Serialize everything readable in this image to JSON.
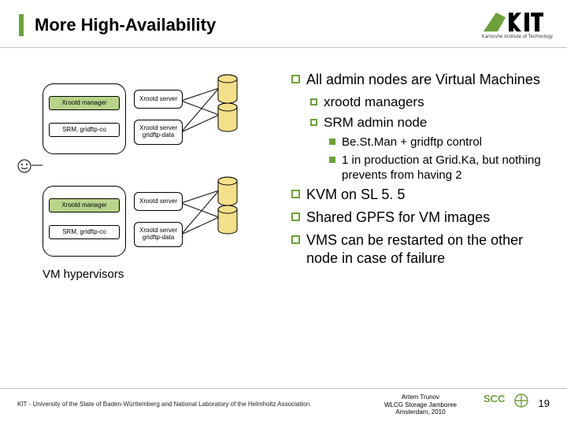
{
  "title": "More High-Availability",
  "logo": {
    "text": "KIT",
    "subtitle": "Karlsruhe Institute of Technology"
  },
  "diagram": {
    "hypervisors_label": "VM hypervisors",
    "vm_boxes": [
      {
        "manager_label": "Xrootd manager",
        "srm_label": "SRM, gridftp-co",
        "server1_label": "Xrootd server",
        "server2_line1": "Xrootd server",
        "server2_line2": "gridftp-data"
      },
      {
        "manager_label": "Xrootd manager",
        "srm_label": "SRM, gridftp-co",
        "server1_label": "Xrootd server",
        "server2_line1": "Xrootd server",
        "server2_line2": "gridftp-data"
      }
    ]
  },
  "bullets": {
    "l1": [
      "All admin nodes are Virtual Machines",
      "KVM on SL 5. 5",
      "Shared GPFS for VM images",
      "VMS can be restarted on the other node in case of failure"
    ],
    "l2": [
      "xrootd managers",
      "SRM admin node"
    ],
    "l3": [
      "Be.St.Man + gridftp control",
      "1 in production at Grid.Ka, but nothing prevents from having 2"
    ]
  },
  "footer": {
    "left": "KIT - University of the State of Baden-Württemberg and National Laboratory of the Helmholtz Association",
    "mid_line1": "Artem Trunov",
    "mid_line2": "WLCG Storage Jamboree",
    "mid_line3": "Amsterdam, 2010",
    "page": "19",
    "scc": "SCC"
  },
  "colors": {
    "accent": "#6ea03a",
    "chip_green": "#b7d48a",
    "db_fill": "#f4e08a"
  }
}
